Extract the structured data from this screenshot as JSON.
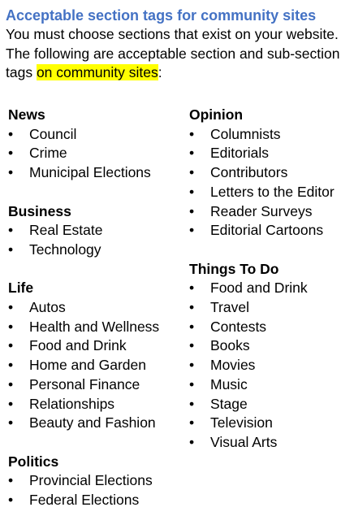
{
  "heading": "Acceptable section tags for community sites",
  "intro": {
    "before": "You must choose sections that exist on your website. The following are acceptable section and sub-section tags ",
    "highlight": "on community sites",
    "after": ":"
  },
  "bullet_char": "•",
  "left_column": [
    {
      "title": "News",
      "items": [
        "Council",
        "Crime",
        "Municipal Elections"
      ]
    },
    {
      "title": "Business",
      "items": [
        "Real Estate",
        "Technology"
      ]
    },
    {
      "title": "Life",
      "items": [
        "Autos",
        "Health and Wellness",
        "Food and Drink",
        "Home and Garden",
        "Personal Finance",
        "Relationships",
        "Beauty and Fashion"
      ]
    },
    {
      "title": "Politics",
      "items": [
        "Provincial Elections",
        "Federal Elections"
      ]
    }
  ],
  "right_column": [
    {
      "title": "Opinion",
      "items": [
        "Columnists",
        "Editorials",
        "Contributors",
        "Letters to the Editor",
        "Reader Surveys",
        "Editorial Cartoons"
      ]
    },
    {
      "title": "Things To Do",
      "items": [
        "Food and Drink",
        "Travel",
        "Contests",
        "Books",
        "Movies",
        "Music",
        "Stage",
        "Television",
        "Visual Arts"
      ]
    }
  ],
  "colors": {
    "heading": "#4472c4",
    "highlight": "#ffff00",
    "text": "#000000"
  }
}
